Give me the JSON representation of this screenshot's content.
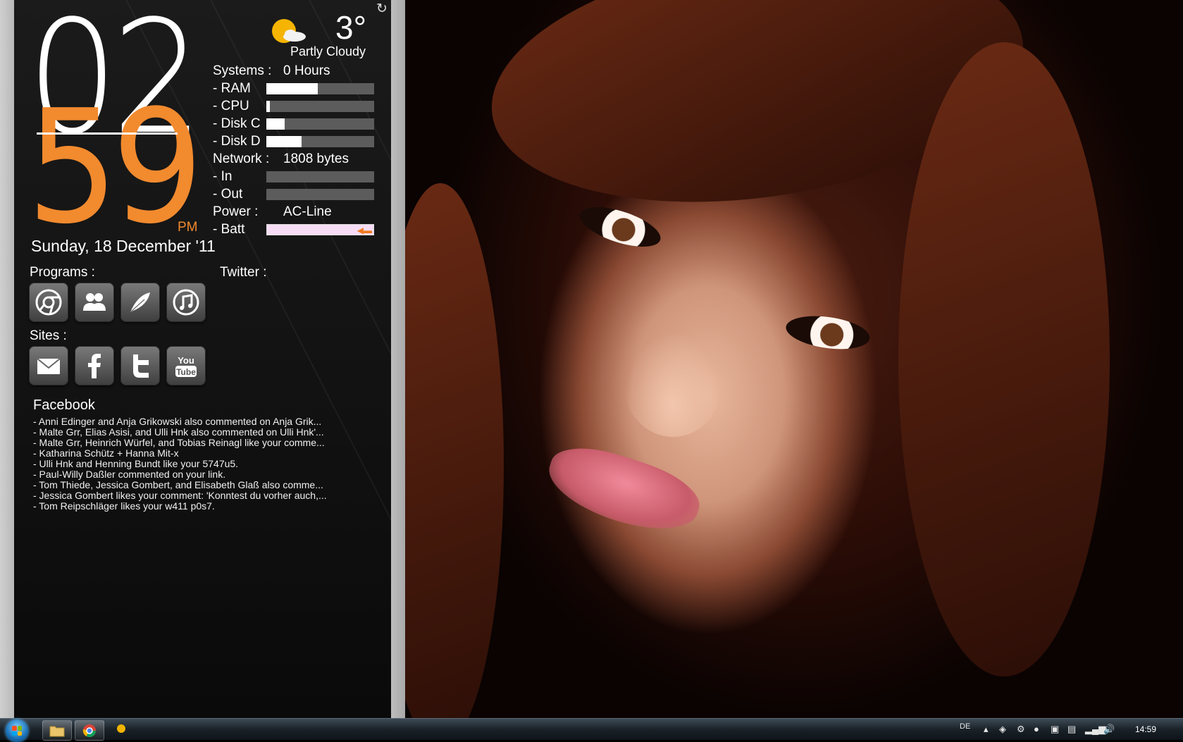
{
  "clock": {
    "hours": "02",
    "minutes": "59",
    "ampm": "PM",
    "date": "Sunday, 18 December '11"
  },
  "weather": {
    "temperature": "3°",
    "condition": "Partly Cloudy",
    "icon": "sun-cloud-icon"
  },
  "system": {
    "uptime_label": "Systems :",
    "uptime_value": "0 Hours",
    "ram_label": "- RAM",
    "ram_usage": 0.48,
    "cpu_label": "- CPU",
    "cpu_usage": 0.03,
    "diskc_label": "- Disk C",
    "diskc_usage": 0.17,
    "diskd_label": "- Disk D",
    "diskd_usage": 0.33,
    "network_label": "Network :",
    "network_value": "1808 bytes",
    "in_label": "- In",
    "in_usage": 0.0,
    "out_label": "- Out",
    "out_usage": 0.0,
    "power_label": "Power :",
    "power_value": "AC-Line",
    "batt_label": "- Batt"
  },
  "programs": {
    "title": "Programs :",
    "items": [
      "chrome-icon",
      "contacts-icon",
      "feather-icon",
      "itunes-icon"
    ]
  },
  "twitter": {
    "title": "Twitter :"
  },
  "sites": {
    "title": "Sites :",
    "items": [
      "mail-icon",
      "facebook-icon",
      "twitter-icon",
      "youtube-icon"
    ]
  },
  "facebook": {
    "title": "Facebook",
    "items": [
      "- Anni Edinger and Anja Grikowski also commented on Anja Grik...",
      "- Malte Grr, Elias Asisi, and Ulli Hnk also commented on Ulli Hnk'...",
      "- Malte Grr, Heinrich Würfel, and Tobias Reinagl like your comme...",
      "- Katharina Schütz + Hanna Mit-x",
      "- Ulli Hnk and Henning Bundt like your 5747u5.",
      "- Paul-Willy Daßler commented on your link.",
      "- Tom Thiede, Jessica Gombert, and Elisabeth Glaß also comme...",
      "- Jessica Gombert likes your comment: 'Konntest du vorher auch,...",
      "- Tom Reipschläger likes your w411 p0s7."
    ]
  },
  "taskbar": {
    "language": "DE",
    "time": "14:59"
  },
  "colors": {
    "accent": "#f28a2e",
    "panel": "#141414",
    "bar_bg": "#5c5c5c"
  }
}
